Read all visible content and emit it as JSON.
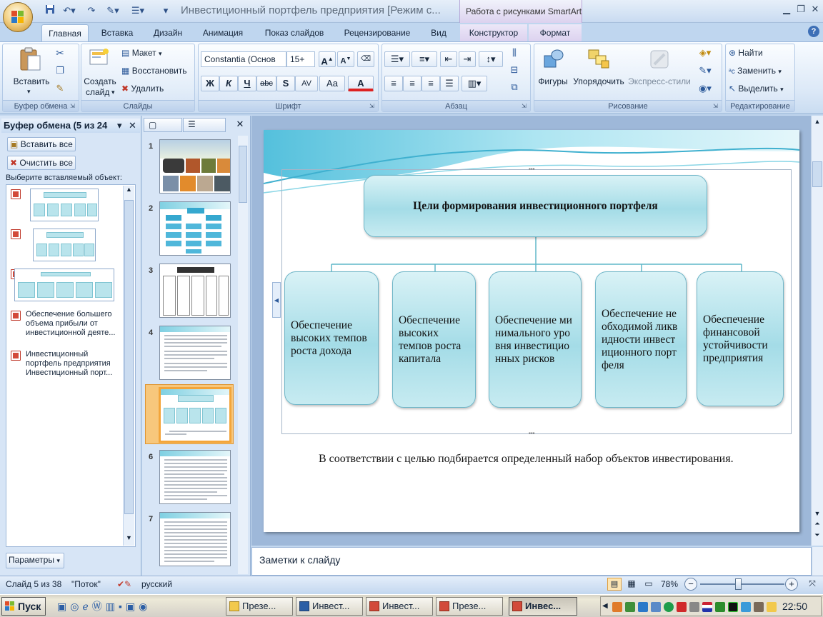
{
  "window": {
    "title": "Инвестиционный портфель предприятия [Режим с...",
    "context_tab_group": "Работа с рисунками SmartArt"
  },
  "tabs": [
    {
      "label": "Главная",
      "active": true
    },
    {
      "label": "Вставка"
    },
    {
      "label": "Дизайн"
    },
    {
      "label": "Анимация"
    },
    {
      "label": "Показ слайдов"
    },
    {
      "label": "Рецензирование"
    },
    {
      "label": "Вид"
    },
    {
      "label": "Конструктор",
      "contextual": true
    },
    {
      "label": "Формат",
      "contextual": true
    }
  ],
  "ribbon": {
    "clipboard": {
      "group_label": "Буфер обмена",
      "paste_label": "Вставить"
    },
    "slides": {
      "group_label": "Слайды",
      "create_label_1": "Создать",
      "create_label_2": "слайд",
      "layout_label": "Макет",
      "reset_label": "Восстановить",
      "delete_label": "Удалить"
    },
    "font": {
      "group_label": "Шрифт",
      "font_name": "Constantia (Основ",
      "font_size": "15+",
      "bold": "Ж",
      "italic": "К",
      "underline": "Ч",
      "strike": "abc",
      "shadow": "S",
      "spacing": "AV",
      "case": "Aa",
      "color": "A"
    },
    "paragraph": {
      "group_label": "Абзац"
    },
    "drawing": {
      "group_label": "Рисование",
      "shapes_label": "Фигуры",
      "arrange_label": "Упорядочить",
      "quick_styles_label": "Экспресс-стили"
    },
    "editing": {
      "group_label": "Редактирование",
      "find_label": "Найти",
      "replace_label": "Заменить",
      "select_label": "Выделить"
    }
  },
  "clipboard_pane": {
    "title": "Буфер обмена (5 из 24",
    "paste_all": "Вставить все",
    "clear_all": "Очистить все",
    "hint": "Выберите вставляемый объект:",
    "items": [
      {
        "type": "image"
      },
      {
        "type": "image"
      },
      {
        "type": "image"
      },
      {
        "type": "text",
        "text": "Обеспечение большего объема прибыли от инвестиционной деяте..."
      },
      {
        "type": "text",
        "text": "Инвестиционный портфель предприятия Инвестиционный порт..."
      }
    ],
    "params_label": "Параметры"
  },
  "thumbnails": {
    "numbers": [
      "1",
      "2",
      "3",
      "4",
      "5",
      "6",
      "7"
    ],
    "selected": "5"
  },
  "slide": {
    "root_label": "Цели формирования инвестиционного портфеля",
    "goals": [
      "Обеспечение высоких темпов роста дохода",
      "Обеспечение высоких темпов роста капитала",
      "Обеспечение минимального уровня инвестиционных рисков",
      "Обеспечение необходимой ликвидности инвестиционного портфеля",
      "Обеспечение финансовой устойчивости предприятия"
    ],
    "body_text": "В соответствии с целью подбирается определенный набор объектов инвестирования."
  },
  "notes": {
    "placeholder": "Заметки к слайду"
  },
  "status": {
    "slide_info": "Слайд 5 из 38",
    "theme": "\"Поток\"",
    "language": "русский",
    "zoom": "78%",
    "zoom_fraction": 0.45
  },
  "taskbar": {
    "start": "Пуск",
    "tasks": [
      {
        "label": "Презе...",
        "active": false
      },
      {
        "label": "Инвест...",
        "active": false
      },
      {
        "label": "Инвест...",
        "active": false
      },
      {
        "label": "Презе...",
        "active": false
      },
      {
        "label": "Инвес...",
        "active": true
      }
    ],
    "clock": "22:50"
  },
  "colors": {
    "ribbon_bg": "#dbe8f7",
    "accent_teal": "#6fb6c8",
    "thumb_selected": "#f3a53a"
  }
}
